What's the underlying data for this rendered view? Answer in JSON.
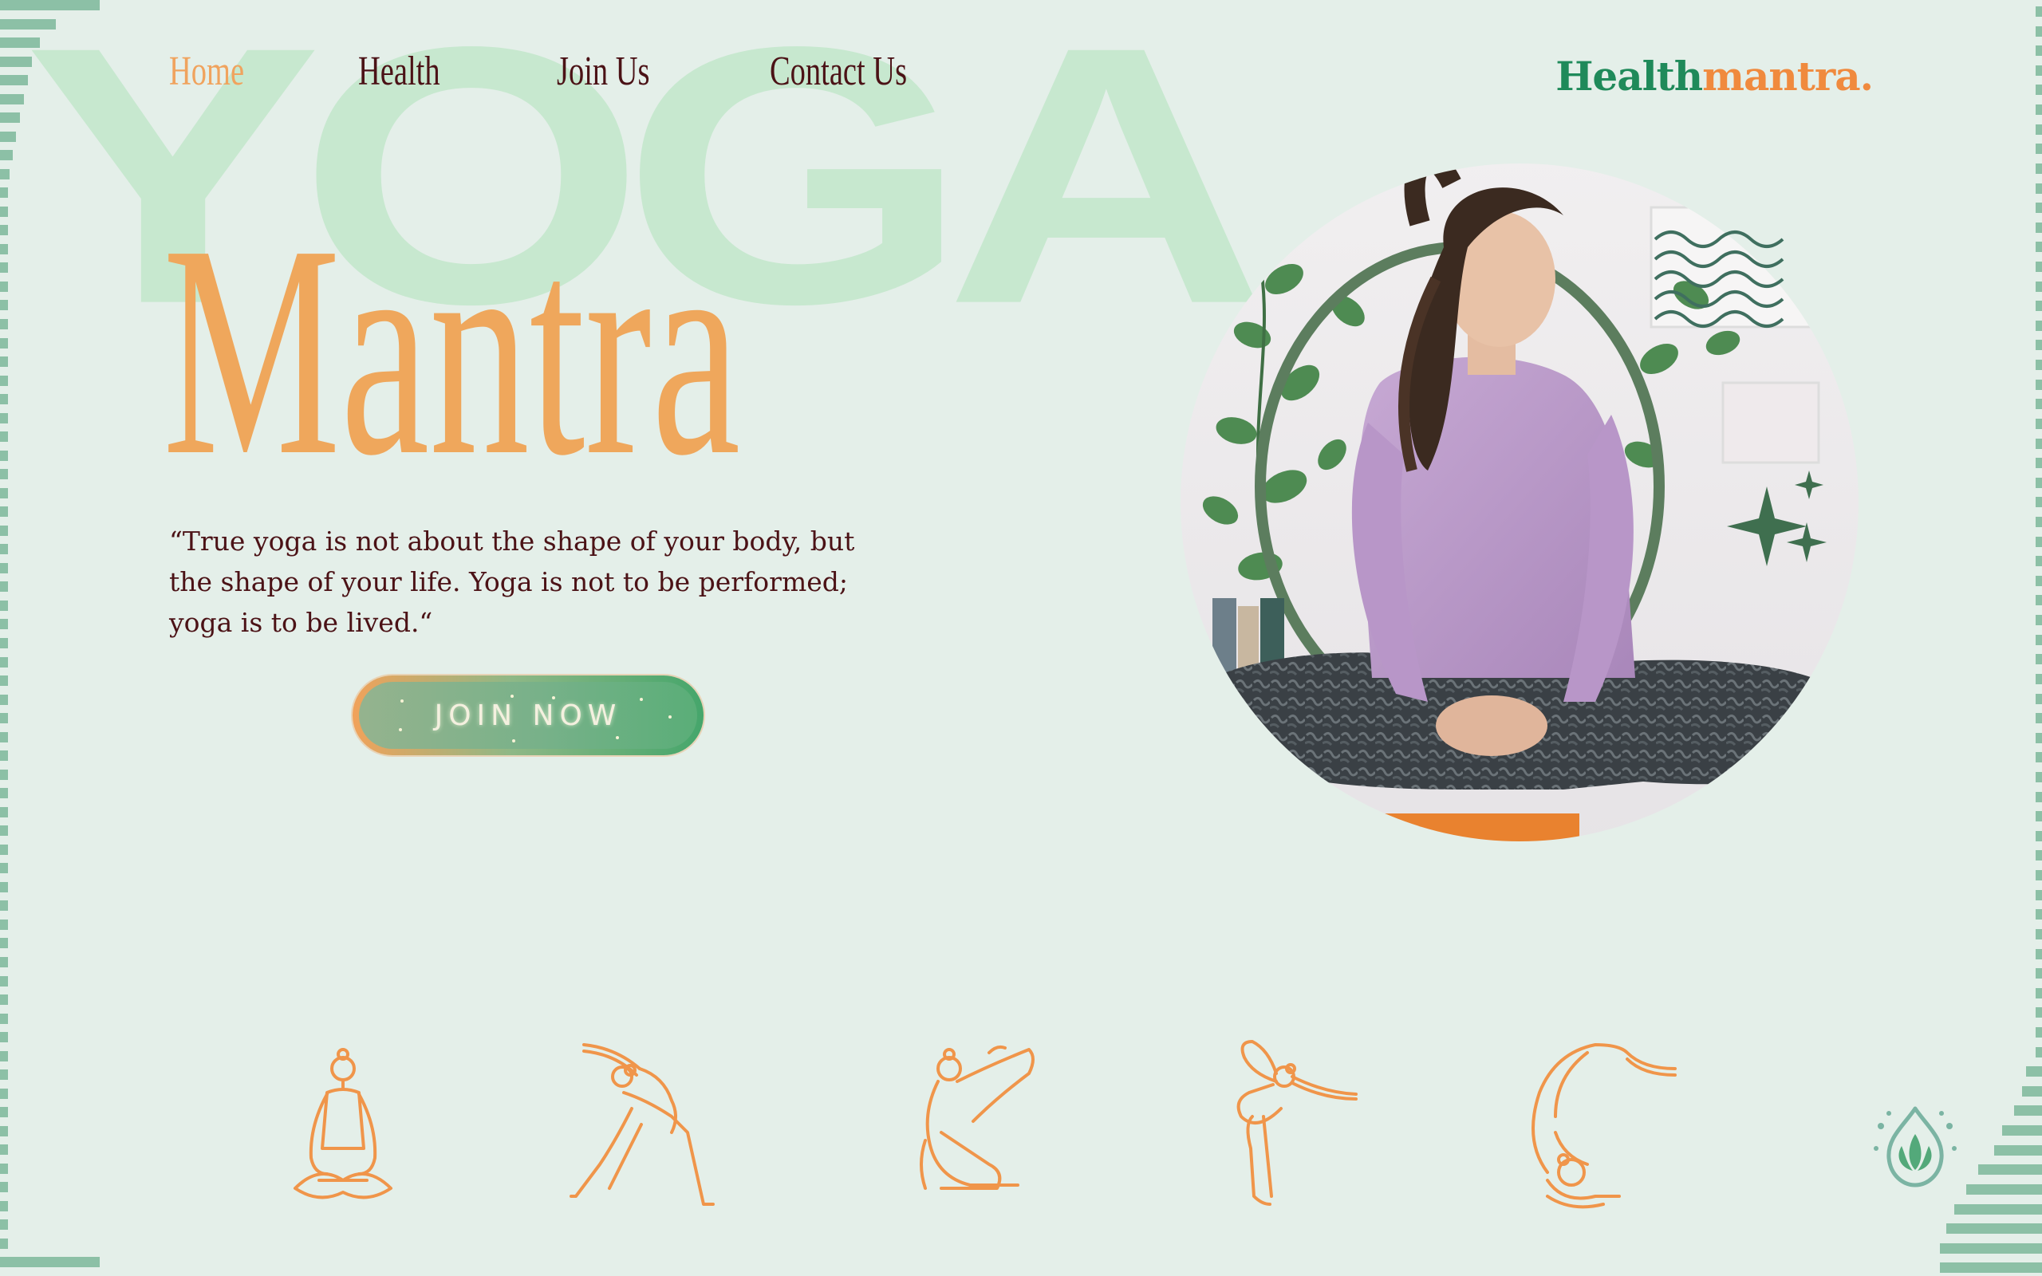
{
  "background_word": "YOGA",
  "nav": {
    "items": [
      {
        "label": "Home",
        "active": true
      },
      {
        "label": "Health",
        "active": false
      },
      {
        "label": "Join Us",
        "active": false
      },
      {
        "label": "Contact Us",
        "active": false
      }
    ]
  },
  "brand": {
    "part1": "Health",
    "part2": "mantra."
  },
  "hero": {
    "title": "Mantra",
    "quote": "“True yoga is not about the shape of your body, but the shape of your life. Yoga is not to be performed; yoga is to be lived.“",
    "cta_label": "JOIN NOW"
  },
  "poses": [
    {
      "icon": "lotus-pose-icon"
    },
    {
      "icon": "triangle-pose-icon"
    },
    {
      "icon": "pigeon-stretch-pose-icon"
    },
    {
      "icon": "dancer-pose-icon"
    },
    {
      "icon": "scorpion-pose-icon"
    }
  ],
  "colors": {
    "background": "#e4efe9",
    "accent_orange": "#efa75c",
    "text_dark": "#4b1216",
    "brand_green": "#1f8a5a",
    "brand_orange": "#f08a3e",
    "watermark": "#c7e8cf",
    "stripe": "#8cc0a6"
  }
}
